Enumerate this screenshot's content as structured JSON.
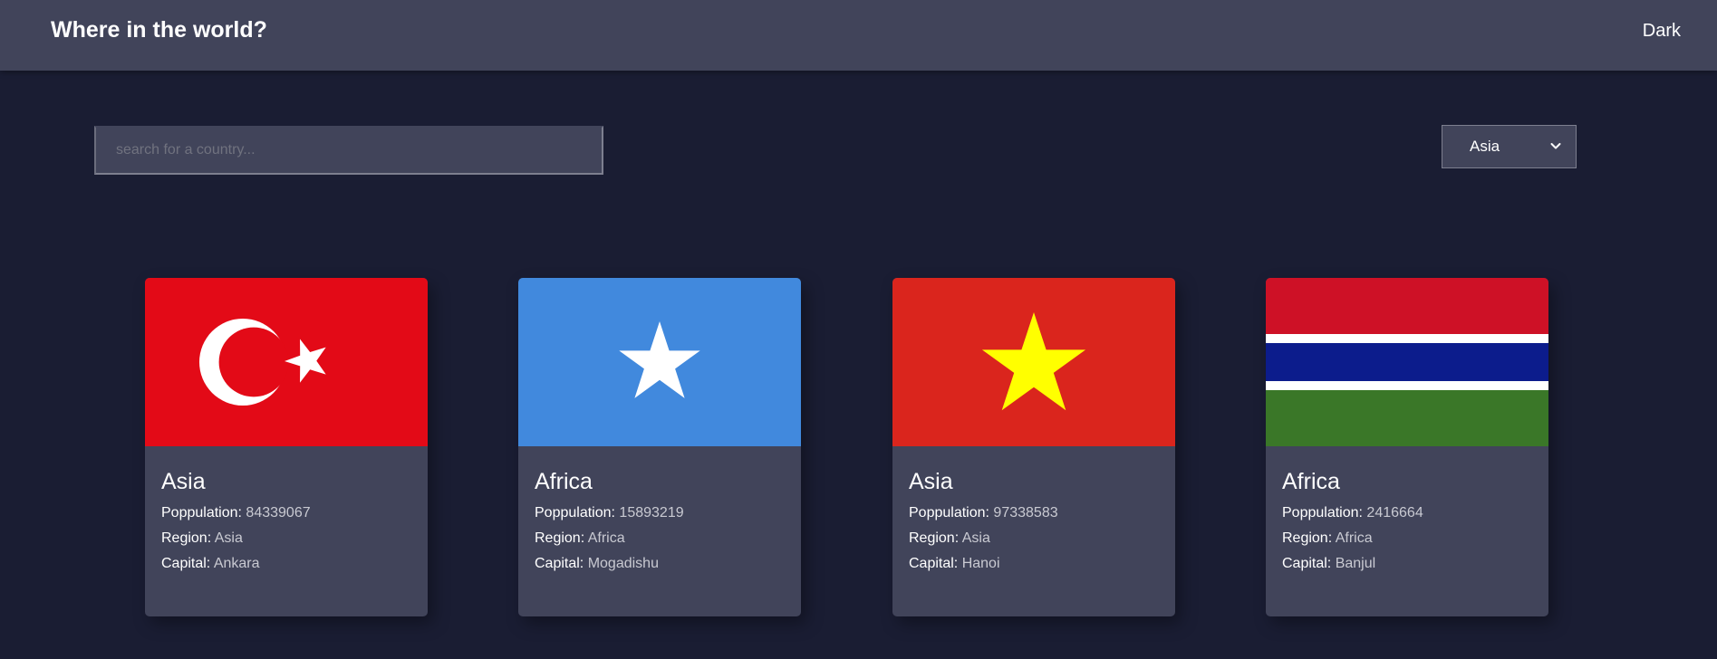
{
  "header": {
    "title": "Where in the world?",
    "mode_label": "Dark"
  },
  "search": {
    "placeholder": "search for a country...",
    "value": ""
  },
  "region_filter": {
    "selected": "Asia"
  },
  "labels": {
    "population": "Poppulation:",
    "region": "Region:",
    "capital": "Capital:"
  },
  "countries": [
    {
      "name": "Asia",
      "population": "84339067",
      "region": "Asia",
      "capital": "Ankara",
      "flag": "turkey-flag"
    },
    {
      "name": "Africa",
      "population": "15893219",
      "region": "Africa",
      "capital": "Mogadishu",
      "flag": "somalia-flag"
    },
    {
      "name": "Asia",
      "population": "97338583",
      "region": "Asia",
      "capital": "Hanoi",
      "flag": "vietnam-flag"
    },
    {
      "name": "Africa",
      "population": "2416664",
      "region": "Africa",
      "capital": "Banjul",
      "flag": "gambia-flag"
    }
  ],
  "colors": {
    "background": "#1a1d33",
    "surface": "#41445a",
    "text": "#ffffff",
    "muted_text": "#c9cad2"
  }
}
